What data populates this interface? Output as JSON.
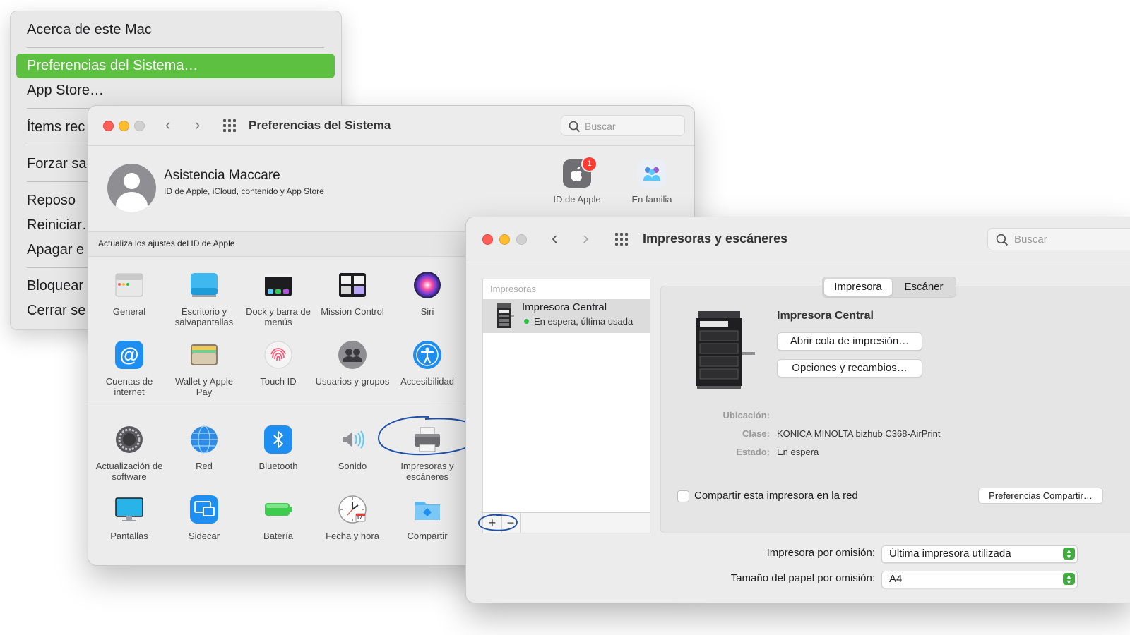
{
  "apple_menu": {
    "items": [
      {
        "label": "Acerca de este Mac"
      },
      {
        "label": "Preferencias del Sistema…"
      },
      {
        "label": "App Store…"
      },
      {
        "label": "Ítems rec"
      },
      {
        "label": "Forzar sa"
      },
      {
        "label": "Reposo"
      },
      {
        "label": "Reiniciar…"
      },
      {
        "label": "Apagar e"
      },
      {
        "label": "Bloquear"
      },
      {
        "label": "Cerrar se"
      }
    ]
  },
  "prefs_window": {
    "title": "Preferencias del Sistema",
    "search_placeholder": "Buscar",
    "user": {
      "name": "Asistencia Maccare",
      "subtitle": "ID de Apple, iCloud, contenido y App Store"
    },
    "apple_id_label": "ID de Apple",
    "apple_id_badge": "1",
    "family_label": "En familia",
    "update_banner": "Actualiza los ajustes del ID de Apple",
    "rows": [
      [
        {
          "label": "General",
          "icon": "general-icon"
        },
        {
          "label": "Escritorio y salvapantallas",
          "icon": "desktop-icon"
        },
        {
          "label": "Dock y barra de menús",
          "icon": "dock-icon"
        },
        {
          "label": "Mission Control",
          "icon": "mission-control-icon"
        },
        {
          "label": "Siri",
          "icon": "siri-icon"
        }
      ],
      [
        {
          "label": "Cuentas de internet",
          "icon": "internet-accounts-icon"
        },
        {
          "label": "Wallet y Apple Pay",
          "icon": "wallet-icon"
        },
        {
          "label": "Touch ID",
          "icon": "touch-id-icon"
        },
        {
          "label": "Usuarios y grupos",
          "icon": "users-icon"
        },
        {
          "label": "Accesibilidad",
          "icon": "accessibility-icon"
        }
      ],
      [
        {
          "label": "Actualización de software",
          "icon": "software-update-icon"
        },
        {
          "label": "Red",
          "icon": "network-icon"
        },
        {
          "label": "Bluetooth",
          "icon": "bluetooth-icon"
        },
        {
          "label": "Sonido",
          "icon": "sound-icon"
        },
        {
          "label": "Impresoras y escáneres",
          "icon": "printer-icon"
        }
      ],
      [
        {
          "label": "Pantallas",
          "icon": "displays-icon"
        },
        {
          "label": "Sidecar",
          "icon": "sidecar-icon"
        },
        {
          "label": "Batería",
          "icon": "battery-icon"
        },
        {
          "label": "Fecha y hora",
          "icon": "clock-icon"
        },
        {
          "label": "Compartir",
          "icon": "sharing-icon"
        }
      ]
    ],
    "calendar_day": "17"
  },
  "printers_window": {
    "title": "Impresoras y escáneres",
    "search_placeholder": "Buscar",
    "list_header": "Impresoras",
    "printer": {
      "name": "Impresora Central",
      "status": "En espera, última usada"
    },
    "add_symbol": "+",
    "remove_symbol": "−",
    "tabs": [
      {
        "label": "Impresora",
        "active": true
      },
      {
        "label": "Escáner",
        "active": false
      }
    ],
    "detail": {
      "name": "Impresora Central",
      "open_queue_button": "Abrir cola de impresión…",
      "options_button": "Opciones y recambios…",
      "location_label": "Ubicación:",
      "location_value": "",
      "class_label": "Clase:",
      "class_value": "KONICA MINOLTA bizhub C368-AirPrint",
      "state_label": "Estado:",
      "state_value": "En espera",
      "share_label": "Compartir esta impresora en la red",
      "share_checked": false,
      "share_prefs_button": "Preferencias Compartir…"
    },
    "default_printer_label": "Impresora por omisión:",
    "default_printer_value": "Última impresora utilizada",
    "default_paper_label": "Tamaño del papel por omisión:",
    "default_paper_value": "A4"
  },
  "colors": {
    "menu_highlight": "#5dc041",
    "annotation": "#1f4fa8",
    "status_green": "#30c048"
  }
}
